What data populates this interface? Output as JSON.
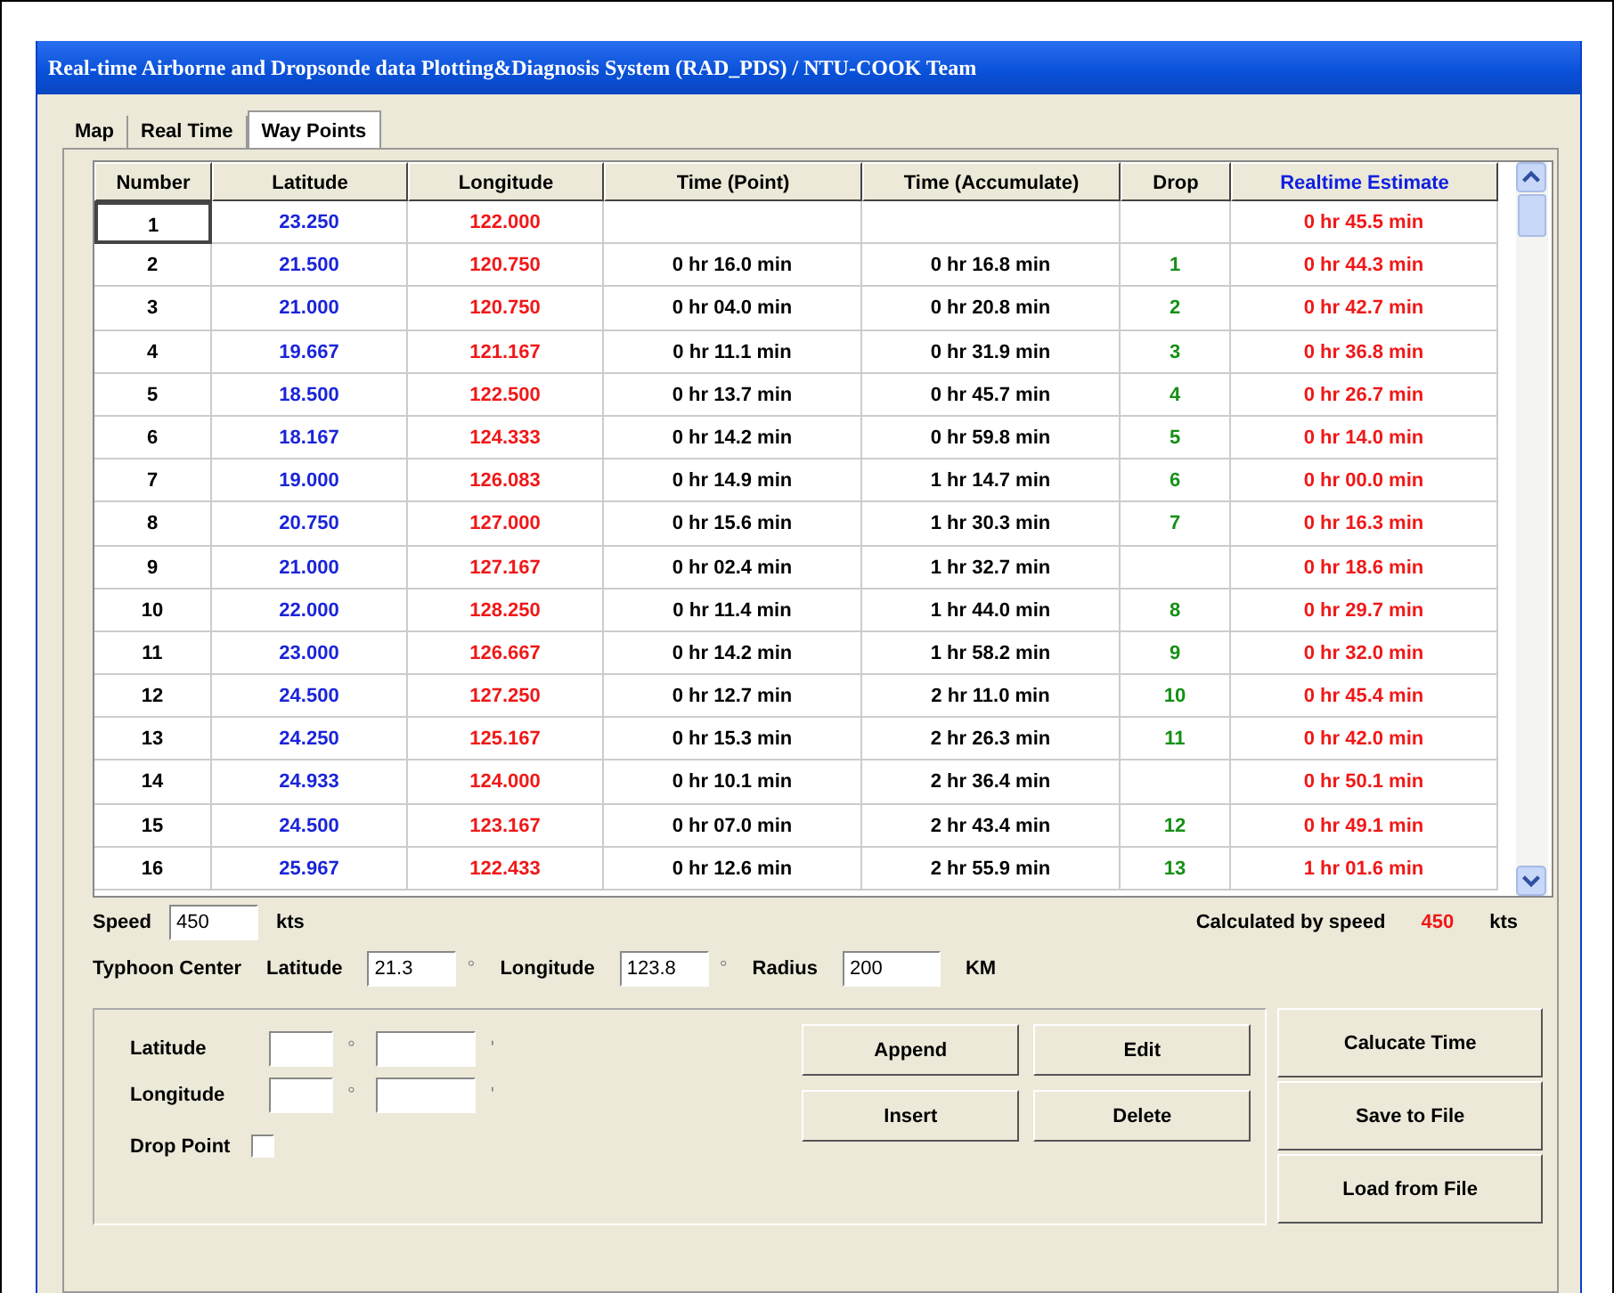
{
  "window": {
    "title": "Real-time Airborne and Dropsonde data Plotting&Diagnosis System (RAD_PDS) / NTU-COOK Team"
  },
  "tabs": [
    {
      "label": "Map",
      "selected": false
    },
    {
      "label": "Real Time",
      "selected": false
    },
    {
      "label": "Way Points",
      "selected": true
    }
  ],
  "table": {
    "columns": [
      "Number",
      "Latitude",
      "Longitude",
      "Time (Point)",
      "Time (Accumulate)",
      "Drop",
      "Realtime Estimate"
    ],
    "rows": [
      {
        "number": "1",
        "latitude": "23.250",
        "longitude": "122.000",
        "time_point": "",
        "time_accumulate": "",
        "drop": "",
        "estimate": "0 hr 45.5 min",
        "focused": true
      },
      {
        "number": "2",
        "latitude": "21.500",
        "longitude": "120.750",
        "time_point": "0 hr 16.0 min",
        "time_accumulate": "0 hr 16.8 min",
        "drop": "1",
        "estimate": "0 hr 44.3 min",
        "focused": false
      },
      {
        "number": "3",
        "latitude": "21.000",
        "longitude": "120.750",
        "time_point": "0 hr 04.0 min",
        "time_accumulate": "0 hr 20.8 min",
        "drop": "2",
        "estimate": "0 hr 42.7 min",
        "focused": false
      },
      {
        "number": "4",
        "latitude": "19.667",
        "longitude": "121.167",
        "time_point": "0 hr 11.1 min",
        "time_accumulate": "0 hr 31.9 min",
        "drop": "3",
        "estimate": "0 hr 36.8 min",
        "focused": false
      },
      {
        "number": "5",
        "latitude": "18.500",
        "longitude": "122.500",
        "time_point": "0 hr 13.7 min",
        "time_accumulate": "0 hr 45.7 min",
        "drop": "4",
        "estimate": "0 hr 26.7 min",
        "focused": false
      },
      {
        "number": "6",
        "latitude": "18.167",
        "longitude": "124.333",
        "time_point": "0 hr 14.2 min",
        "time_accumulate": "0 hr 59.8 min",
        "drop": "5",
        "estimate": "0 hr 14.0 min",
        "focused": false
      },
      {
        "number": "7",
        "latitude": "19.000",
        "longitude": "126.083",
        "time_point": "0 hr 14.9 min",
        "time_accumulate": "1 hr 14.7 min",
        "drop": "6",
        "estimate": "0 hr 00.0 min",
        "focused": false
      },
      {
        "number": "8",
        "latitude": "20.750",
        "longitude": "127.000",
        "time_point": "0 hr 15.6 min",
        "time_accumulate": "1 hr 30.3 min",
        "drop": "7",
        "estimate": "0 hr 16.3 min",
        "focused": false
      },
      {
        "number": "9",
        "latitude": "21.000",
        "longitude": "127.167",
        "time_point": "0 hr 02.4 min",
        "time_accumulate": "1 hr 32.7 min",
        "drop": "",
        "estimate": "0 hr 18.6 min",
        "focused": false
      },
      {
        "number": "10",
        "latitude": "22.000",
        "longitude": "128.250",
        "time_point": "0 hr 11.4 min",
        "time_accumulate": "1 hr 44.0 min",
        "drop": "8",
        "estimate": "0 hr 29.7 min",
        "focused": false
      },
      {
        "number": "11",
        "latitude": "23.000",
        "longitude": "126.667",
        "time_point": "0 hr 14.2 min",
        "time_accumulate": "1 hr 58.2 min",
        "drop": "9",
        "estimate": "0 hr 32.0 min",
        "focused": false
      },
      {
        "number": "12",
        "latitude": "24.500",
        "longitude": "127.250",
        "time_point": "0 hr 12.7 min",
        "time_accumulate": "2 hr 11.0 min",
        "drop": "10",
        "estimate": "0 hr 45.4 min",
        "focused": false
      },
      {
        "number": "13",
        "latitude": "24.250",
        "longitude": "125.167",
        "time_point": "0 hr 15.3 min",
        "time_accumulate": "2 hr 26.3 min",
        "drop": "11",
        "estimate": "0 hr 42.0 min",
        "focused": false
      },
      {
        "number": "14",
        "latitude": "24.933",
        "longitude": "124.000",
        "time_point": "0 hr 10.1 min",
        "time_accumulate": "2 hr 36.4 min",
        "drop": "",
        "estimate": "0 hr 50.1 min",
        "focused": false
      },
      {
        "number": "15",
        "latitude": "24.500",
        "longitude": "123.167",
        "time_point": "0 hr 07.0 min",
        "time_accumulate": "2 hr 43.4 min",
        "drop": "12",
        "estimate": "0 hr 49.1 min",
        "focused": false
      },
      {
        "number": "16",
        "latitude": "25.967",
        "longitude": "122.433",
        "time_point": "0 hr 12.6 min",
        "time_accumulate": "2 hr 55.9 min",
        "drop": "13",
        "estimate": "1 hr 01.6 min",
        "focused": false
      }
    ]
  },
  "speed": {
    "label": "Speed",
    "value": "450",
    "unit": "kts",
    "calculated_label": "Calculated by speed",
    "calculated_value": "450",
    "calculated_unit": "kts"
  },
  "typhoon_center": {
    "label": "Typhoon Center",
    "latitude_label": "Latitude",
    "latitude": "21.3",
    "latitude_unit": "°",
    "longitude_label": "Longitude",
    "longitude": "123.8",
    "longitude_unit": "°",
    "radius_label": "Radius",
    "radius": "200",
    "radius_unit": "KM"
  },
  "point_entry": {
    "latitude_label": "Latitude",
    "longitude_label": "Longitude",
    "degree_sign": "°",
    "minute_sign": "'",
    "drop_point_label": "Drop Point",
    "drop_point_checked": false
  },
  "edit_buttons": [
    "Append",
    "Edit",
    "Insert",
    "Delete"
  ],
  "file_buttons": [
    "Calucate Time",
    "Save to File",
    "Load from File"
  ]
}
